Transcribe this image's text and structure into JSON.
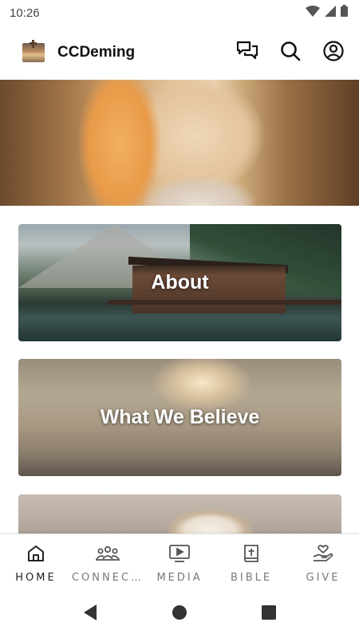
{
  "status_bar": {
    "time": "10:26",
    "icons": [
      "wifi-icon",
      "cell-signal-icon",
      "battery-icon"
    ]
  },
  "app_bar": {
    "title": "CCDeming",
    "actions": [
      "chat-icon",
      "search-icon",
      "account-icon"
    ]
  },
  "cards": [
    {
      "label": "About"
    },
    {
      "label": "What We Believe"
    },
    {
      "label": ""
    }
  ],
  "bottom_nav": {
    "items": [
      {
        "label": "HOME",
        "icon": "home-icon",
        "active": true
      },
      {
        "label": "CONNEC…",
        "icon": "people-icon",
        "active": false
      },
      {
        "label": "MEDIA",
        "icon": "media-icon",
        "active": false
      },
      {
        "label": "BIBLE",
        "icon": "bible-icon",
        "active": false
      },
      {
        "label": "GIVE",
        "icon": "give-icon",
        "active": false
      }
    ]
  },
  "system_nav": [
    "back-icon",
    "home-circle-icon",
    "recents-icon"
  ],
  "colors": {
    "text_primary": "#111111",
    "nav_inactive": "#777777",
    "icon": "#222222"
  }
}
